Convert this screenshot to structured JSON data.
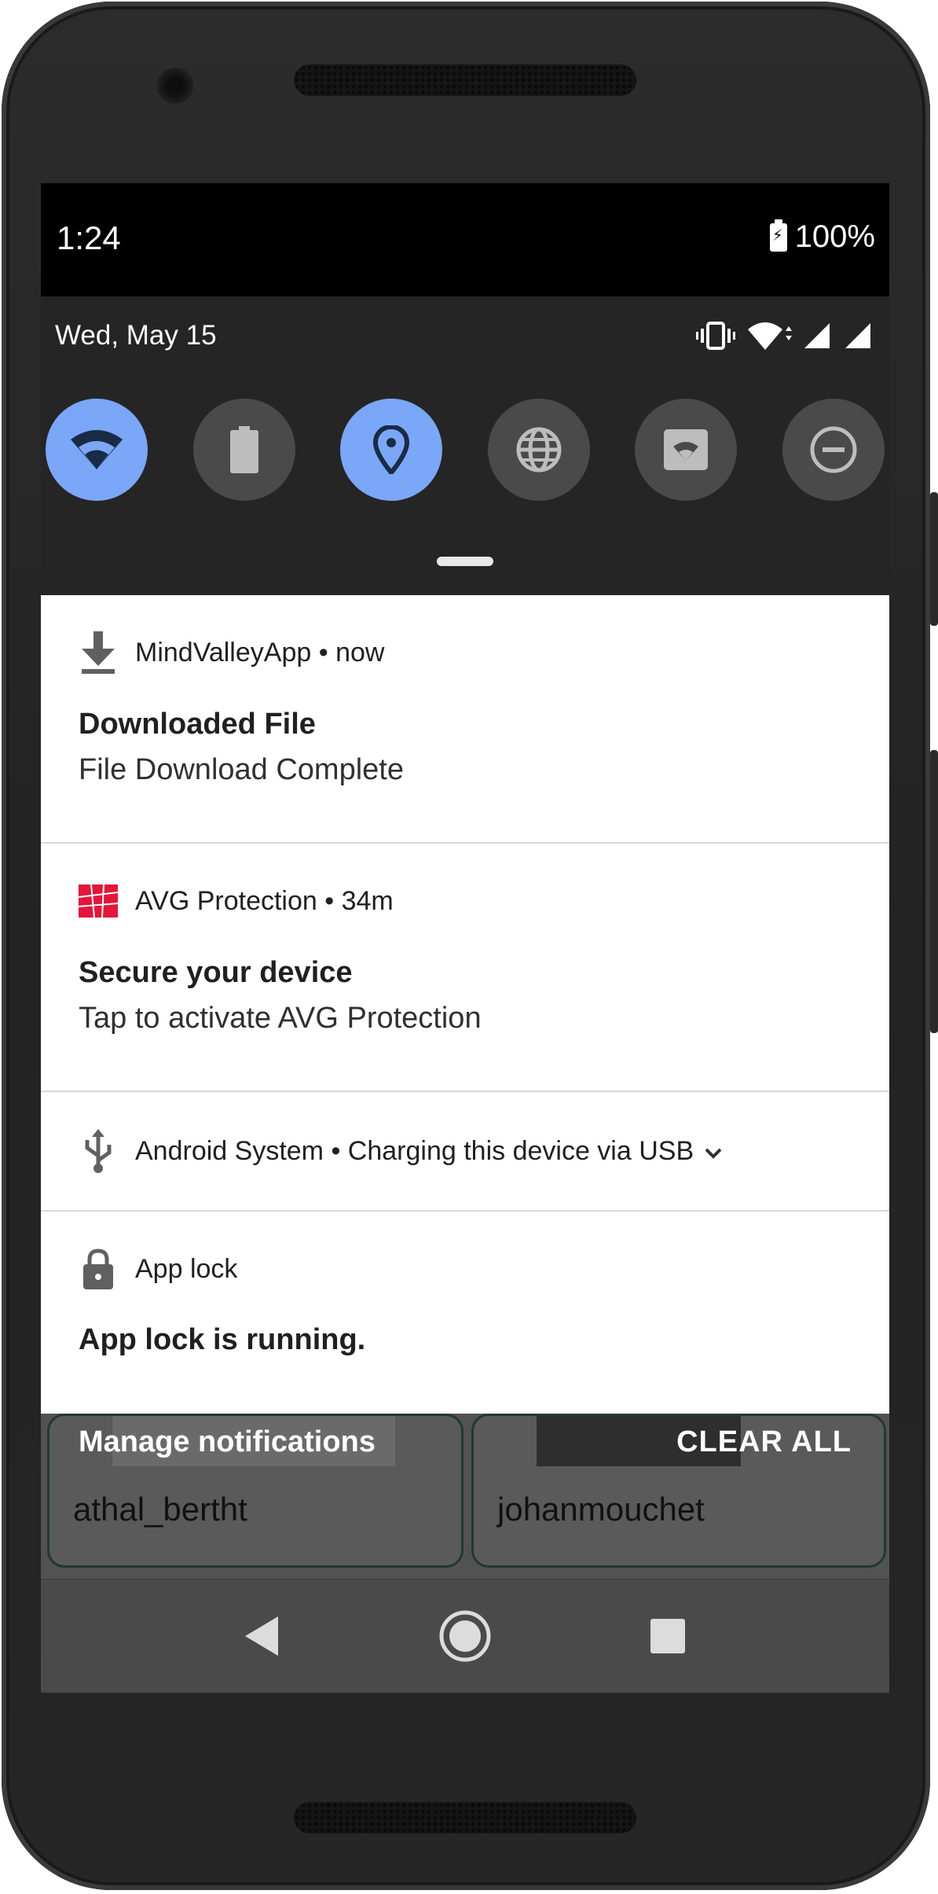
{
  "statusbar": {
    "time": "1:24",
    "battery": "100%"
  },
  "quick_settings": {
    "date": "Wed, May 15",
    "tiles": [
      {
        "name": "wifi",
        "active": true
      },
      {
        "name": "battery-saver",
        "active": false
      },
      {
        "name": "location",
        "active": true
      },
      {
        "name": "data-saver",
        "active": false
      },
      {
        "name": "cast",
        "active": false
      },
      {
        "name": "do-not-disturb",
        "active": false
      }
    ]
  },
  "notifications": [
    {
      "app": "MindValleyApp",
      "time": "now",
      "title": "Downloaded File",
      "body": "File Download Complete",
      "icon": "download-icon"
    },
    {
      "app": "AVG Protection",
      "time": "34m",
      "title": "Secure your device",
      "body": "Tap to activate AVG Protection",
      "icon": "avg-icon"
    },
    {
      "app": "Android System",
      "summary": "Charging this device via USB",
      "icon": "usb-icon"
    },
    {
      "app": "App lock",
      "title": "App lock is running.",
      "icon": "lock-icon"
    }
  ],
  "footer": {
    "manage": "Manage notifications",
    "clear_all": "CLEAR ALL"
  },
  "background_cards": [
    "athal_bertht",
    "johanmouchet"
  ],
  "colors": {
    "tile_active": "#7aa7f7",
    "tile_inactive": "#4a4a4a",
    "avg_red": "#e4163a"
  }
}
